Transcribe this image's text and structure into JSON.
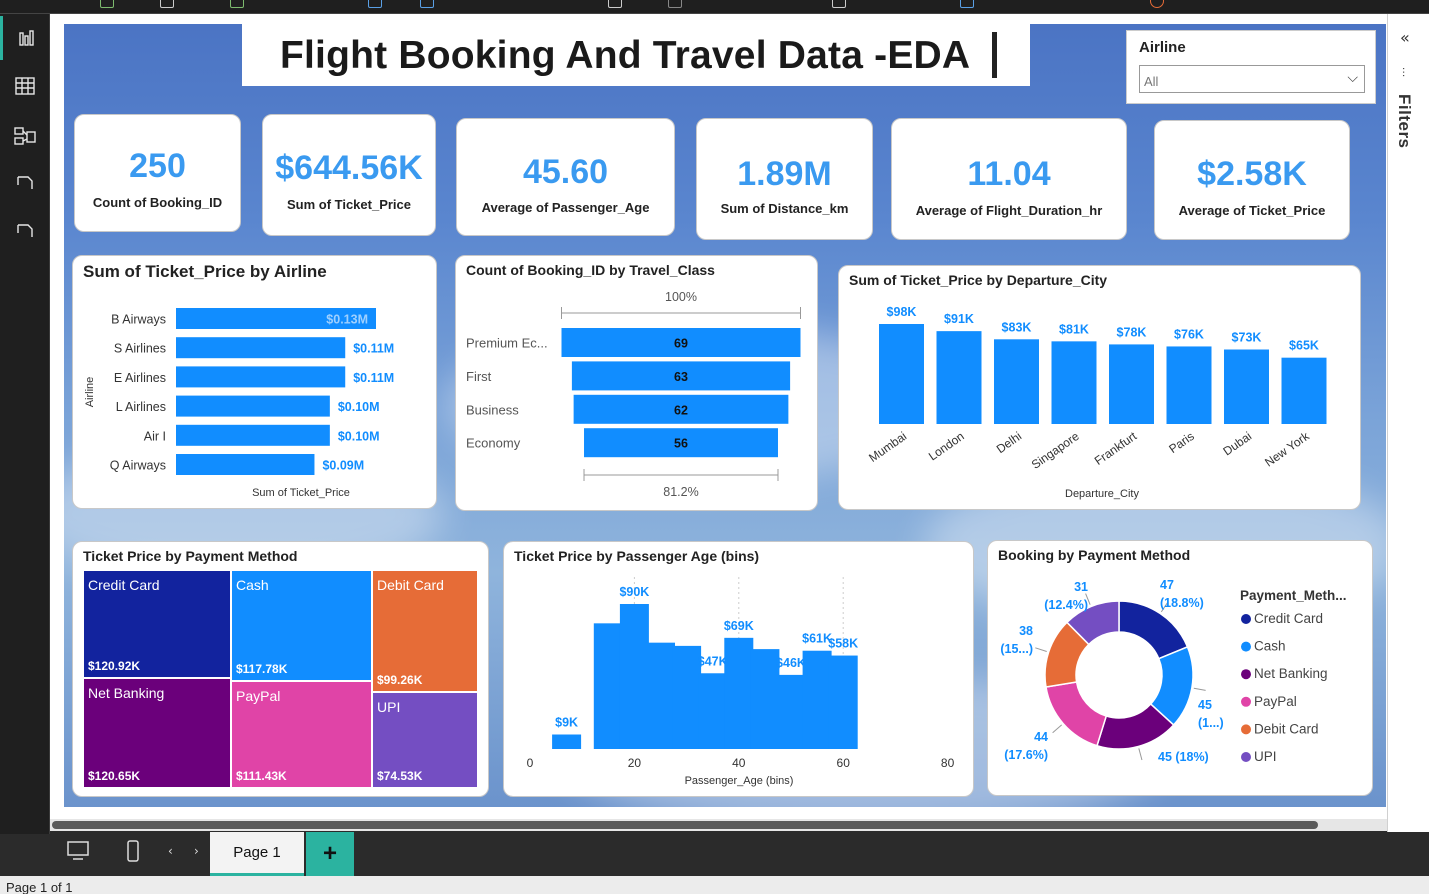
{
  "dashboard": {
    "title": "Flight Booking And Travel Data -EDA",
    "slicer": {
      "label": "Airline",
      "value": "All"
    },
    "filters_label": "Filters",
    "page_tab": "Page 1",
    "status": "Page 1 of 1"
  },
  "kpis": [
    {
      "value": "250",
      "label": "Count of Booking_ID"
    },
    {
      "value": "$644.56K",
      "label": "Sum of Ticket_Price"
    },
    {
      "value": "45.60",
      "label": "Average of Passenger_Age"
    },
    {
      "value": "1.89M",
      "label": "Sum of Distance_km"
    },
    {
      "value": "11.04",
      "label": "Average of Flight_Duration_hr"
    },
    {
      "value": "$2.58K",
      "label": "Average of Ticket_Price"
    }
  ],
  "chart_titles": {
    "airline": "Sum of Ticket_Price by Airline",
    "travel_class": "Count of Booking_ID by Travel_Class",
    "departure": "Sum of Ticket_Price by Departure_City",
    "payment_tree": "Ticket Price by Payment Method",
    "age": "Ticket Price by Passenger Age (bins)",
    "donut": "Booking by Payment Method"
  },
  "chart_data": [
    {
      "type": "bar",
      "orientation": "horizontal",
      "title": "Sum of Ticket_Price by Airline",
      "categories": [
        "B Airways",
        "S Airlines",
        "E Airlines",
        "L Airlines",
        "Air I",
        "Q Airways"
      ],
      "values": [
        0.13,
        0.11,
        0.11,
        0.1,
        0.1,
        0.09
      ],
      "data_labels": [
        "$0.13M",
        "$0.11M",
        "$0.11M",
        "$0.10M",
        "$0.10M",
        "$0.09M"
      ],
      "xlabel": "Sum of Ticket_Price",
      "ylabel": "Airline",
      "color": "#118dff"
    },
    {
      "type": "bar",
      "subtype": "funnel",
      "title": "Count of Booking_ID by Travel_Class",
      "categories": [
        "Premium Ec...",
        "First",
        "Business",
        "Economy"
      ],
      "values": [
        69,
        63,
        62,
        56
      ],
      "top_label": "100%",
      "bottom_label": "81.2%",
      "color": "#118dff"
    },
    {
      "type": "bar",
      "title": "Sum of Ticket_Price by Departure_City",
      "categories": [
        "Mumbai",
        "London",
        "Delhi",
        "Singapore",
        "Frankfurt",
        "Paris",
        "Dubai",
        "New York"
      ],
      "values": [
        98,
        91,
        83,
        81,
        78,
        76,
        73,
        65
      ],
      "data_labels": [
        "$98K",
        "$91K",
        "$83K",
        "$81K",
        "$78K",
        "$76K",
        "$73K",
        "$65K"
      ],
      "xlabel": "Departure_City",
      "color": "#118dff"
    },
    {
      "type": "heatmap",
      "subtype": "treemap",
      "title": "Ticket Price by Payment Method",
      "categories": [
        "Credit Card",
        "Net Banking",
        "Cash",
        "PayPal",
        "Debit Card",
        "UPI"
      ],
      "values": [
        120.92,
        120.65,
        117.78,
        111.43,
        99.26,
        74.53
      ],
      "data_labels": [
        "$120.92K",
        "$120.65K",
        "$117.78K",
        "$111.43K",
        "$99.26K",
        "$74.53K"
      ],
      "colors": [
        "#12239e",
        "#6b007b",
        "#118dff",
        "#e044a7",
        "#e66c37",
        "#744ec2"
      ]
    },
    {
      "type": "bar",
      "title": "Ticket Price by Passenger Age (bins)",
      "x": [
        5,
        10,
        15,
        20,
        25,
        30,
        35,
        40,
        45,
        50,
        55,
        60,
        65,
        70,
        75
      ],
      "values": [
        9,
        78,
        90,
        66,
        64,
        47,
        69,
        62,
        46,
        61,
        58
      ],
      "bar_x": [
        10,
        15,
        20,
        25,
        30,
        35,
        40,
        45,
        50,
        55,
        60
      ],
      "values_full": [
        9,
        78,
        90,
        66,
        64,
        47,
        69,
        62,
        46,
        61,
        58
      ],
      "data_labels": {
        "10": "$9K",
        "20": "$90K",
        "35": "$47K",
        "40": "$69K",
        "50": "$46K",
        "55": "$61K",
        "60": "$58K"
      },
      "xlabel": "Passenger_Age (bins)",
      "xticks": [
        "0",
        "20",
        "40",
        "60",
        "80"
      ],
      "color": "#118dff"
    },
    {
      "type": "pie",
      "subtype": "donut",
      "title": "Booking by Payment Method",
      "legend_title": "Payment_Meth...",
      "categories": [
        "Credit Card",
        "Cash",
        "Net Banking",
        "PayPal",
        "Debit Card",
        "UPI"
      ],
      "values": [
        47,
        45,
        45,
        44,
        38,
        31
      ],
      "data_labels": [
        "47\n(18.8%)",
        "45\n(1...)",
        "45 (18%)",
        "44\n(17.6%)",
        "38\n(15...)",
        "31\n(12.4%)"
      ],
      "colors": [
        "#12239e",
        "#118dff",
        "#6b007b",
        "#e044a7",
        "#e66c37",
        "#744ec2"
      ]
    }
  ]
}
